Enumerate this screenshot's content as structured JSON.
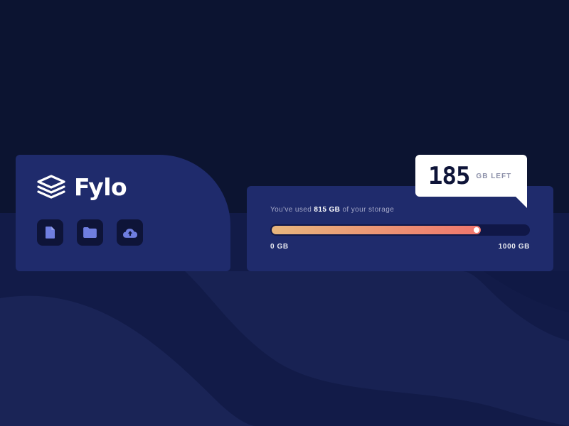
{
  "brand": {
    "name": "Fylo",
    "logo_icon": "layers-icon"
  },
  "actions": [
    {
      "icon": "document-icon"
    },
    {
      "icon": "folder-icon"
    },
    {
      "icon": "cloud-upload-icon"
    }
  ],
  "storage": {
    "usage_prefix": "You've used",
    "used_amount": "815 GB",
    "usage_suffix": "of your storage",
    "used_fraction": 0.815,
    "min_label": "0 GB",
    "max_label": "1000 GB",
    "remaining_value": "185",
    "remaining_unit": "GB LEFT"
  },
  "colors": {
    "background": "#0c1431",
    "card": "#1f2b6c",
    "button_bg": "#0e1438",
    "icon": "#6f7ee0",
    "gradient_start": "#e7b67d",
    "gradient_end": "#f0766d"
  }
}
